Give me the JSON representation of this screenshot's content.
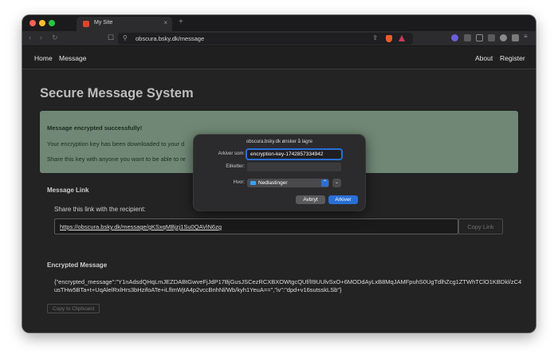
{
  "browser": {
    "tab_title": "My Site",
    "tab_close": "×",
    "new_tab": "+",
    "url": "obscura.bsky.dk/message",
    "back": "‹",
    "forward": "›",
    "reload": "↻",
    "bookmark": "☐",
    "tune": "⚲",
    "share": "⇪",
    "colors": {
      "close": "#ff5f57",
      "minimize": "#febc2e",
      "maximize": "#28c840"
    }
  },
  "site_nav": {
    "home": "Home",
    "message": "Message",
    "about": "About",
    "register": "Register"
  },
  "main": {
    "title": "Secure Message System",
    "success": {
      "headline": "Message encrypted successfully!",
      "line1": "Your encryption key has been downloaded to your d",
      "line2": "Share this key with anyone you want to be able to re"
    },
    "message_link": {
      "title": "Message Link",
      "label": "Share this link with the recipient:",
      "url": "https://obscura.bsky.dk/message/gKSxqMBjzj1Su0QAViN6zg",
      "copy_button": "Copy Link"
    },
    "encrypted": {
      "title": "Encrypted Message",
      "content": "{\"encrypted_message\":\"Y1nAdsdQHqLmJEZDABtGwveFjJdP17BjGusJSCezRCXBXOWtgcQUf/lI9UUlvSxO+6MODdAyLxB8MqJAMFpuhS0UgTdlhZcg1ZTWhTClO1KBDkl/zC4usTHw5BTa+t+UqAlelRxlHrs3bHzifoATe+iLflmWjtA4p2vccBnhNl/Wb/kyh1YeuA==\",\"iv\":\"dpd+v16sutsskLSb\"}",
      "copy_button": "Copy to Clipboard"
    }
  },
  "save_dialog": {
    "title": "obscura.bsky.dk ønsker å lagre",
    "save_as_label": "Arkiver som:",
    "save_as_value": "encryption-key-1742857334942",
    "tags_label": "Etiketter:",
    "tags_value": "",
    "where_label": "Hvor:",
    "where_value": "Nedlastinger",
    "cancel": "Avbryt",
    "save": "Arkiver",
    "select_arrow": "⌃",
    "expand": "⌄"
  }
}
